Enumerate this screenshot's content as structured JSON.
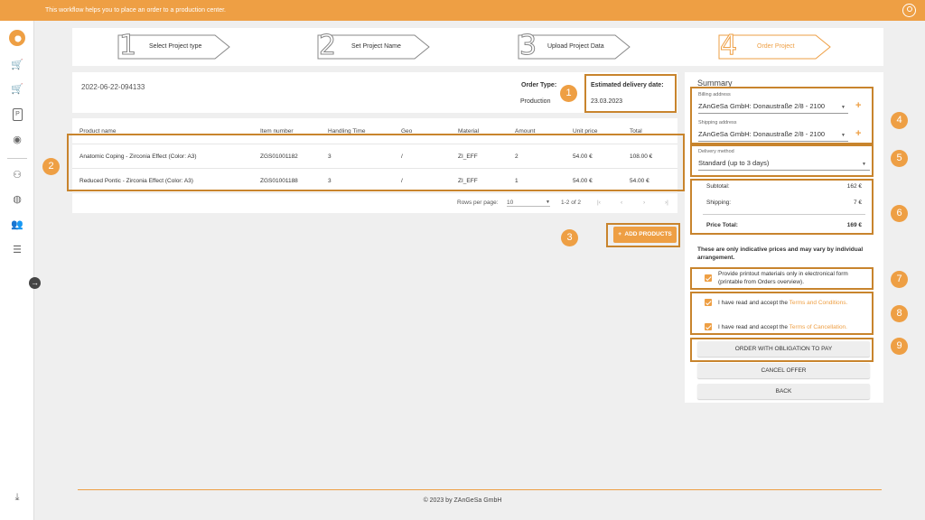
{
  "topbar": {
    "message": "This workflow helps you to place an order to a production center."
  },
  "steps": [
    {
      "num": "1",
      "label": "Select Project type"
    },
    {
      "num": "2",
      "label": "Set Project Name"
    },
    {
      "num": "3",
      "label": "Upload Project Data"
    },
    {
      "num": "4",
      "label": "Order Project"
    }
  ],
  "project": {
    "id": "2022-06-22-094133",
    "order_type_label": "Order Type:",
    "order_type_value": "Production",
    "delivery_label": "Estimated delivery date:",
    "delivery_value": "23.03.2023"
  },
  "table": {
    "headers": [
      "Product name",
      "Item number",
      "Handling Time",
      "Geo",
      "Material",
      "Amount",
      "Unit price",
      "Total"
    ],
    "rows": [
      [
        "Anatomic Coping - Zirconia Effect (Color: A3)",
        "ZGS01001182",
        "3",
        "/",
        "ZI_EFF",
        "2",
        "54.00 €",
        "108.00 €"
      ],
      [
        "Reduced Pontic - Zirconia Effect (Color: A3)",
        "ZGS01001188",
        "3",
        "/",
        "ZI_EFF",
        "1",
        "54.00 €",
        "54.00 €"
      ]
    ],
    "rows_per_page_label": "Rows per page:",
    "rows_per_page_value": "10",
    "range": "1-2 of 2"
  },
  "add_products_label": "ADD PRODUCTS",
  "summary": {
    "title": "Summary",
    "billing_label": "Billing address",
    "billing_value": "ZAnGeSa GmbH: Donaustraße 2/8 - 2100",
    "shipping_label": "Shipping address",
    "shipping_value": "ZAnGeSa GmbH: Donaustraße 2/8 - 2100",
    "delivery_method_label": "Delivery method",
    "delivery_method_value": "Standard (up to 3 days)",
    "subtotal_label": "Subtotal:",
    "subtotal_value": "162 €",
    "shipping_cost_label": "Shipping:",
    "shipping_cost_value": "7 €",
    "total_label": "Price Total:",
    "total_value": "169 €",
    "note": "These are only indicative prices and may vary by individual arrangement.",
    "printout_text": "Provide printout materials only in electronical form (printable from Orders overview).",
    "terms_prefix": "I have read and accept the ",
    "terms_link": "Terms and Conditions.",
    "cancel_prefix": "I have read and accept the ",
    "cancel_link": "Terms of Cancellation.",
    "order_button": "ORDER WITH OBLIGATION TO PAY",
    "cancel_button": "CANCEL OFFER",
    "back_button": "BACK"
  },
  "badges": [
    "1",
    "2",
    "3",
    "4",
    "5",
    "6",
    "7",
    "8",
    "9"
  ],
  "footer": "© 2023 by ZAnGeSa GmbH",
  "colors": {
    "accent": "#ee9f44",
    "highlight": "#c8842d"
  }
}
